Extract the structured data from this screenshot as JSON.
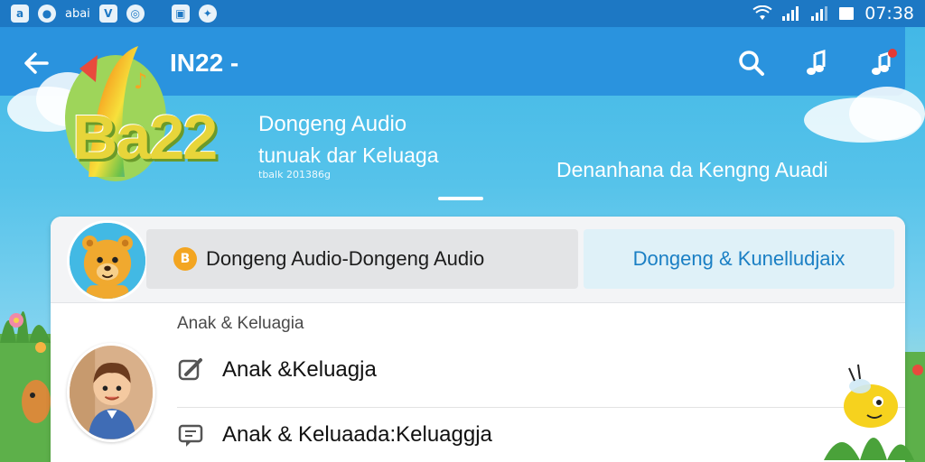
{
  "status_bar": {
    "left_icons": [
      "a-icon",
      "dot-icon",
      "text-icon",
      "v-icon",
      "shield-icon",
      "image-icon",
      "compass-icon"
    ],
    "carrier": "abai",
    "time": "07:38"
  },
  "toolbar": {
    "title": "IN22 -",
    "actions": [
      "search-icon",
      "music-note-icon",
      "music-record-icon"
    ]
  },
  "banner": {
    "logo_text": "Ba22",
    "title": "Dongeng Audio",
    "subtitle": "tunuak dar Keluaga",
    "small_text": "tbalk 201386g",
    "caption": "Denanhana da Kengng Auadi"
  },
  "card": {
    "pill_left_label": "Dongeng Audio-Dongeng Audio",
    "pill_left_icon": "B",
    "pill_right_label": "Dongeng & Kunelludjaix",
    "section_label": "Anak & Keluagia",
    "rows": [
      {
        "icon": "edit-icon",
        "text": "Anak &Keluagja"
      },
      {
        "icon": "comment-icon",
        "text": "Anak & Keluaada:Keluaggja"
      }
    ]
  },
  "colors": {
    "toolbar": "#2a93de",
    "status_bar": "#1d78c4",
    "accent_text": "#1a7fc4"
  }
}
